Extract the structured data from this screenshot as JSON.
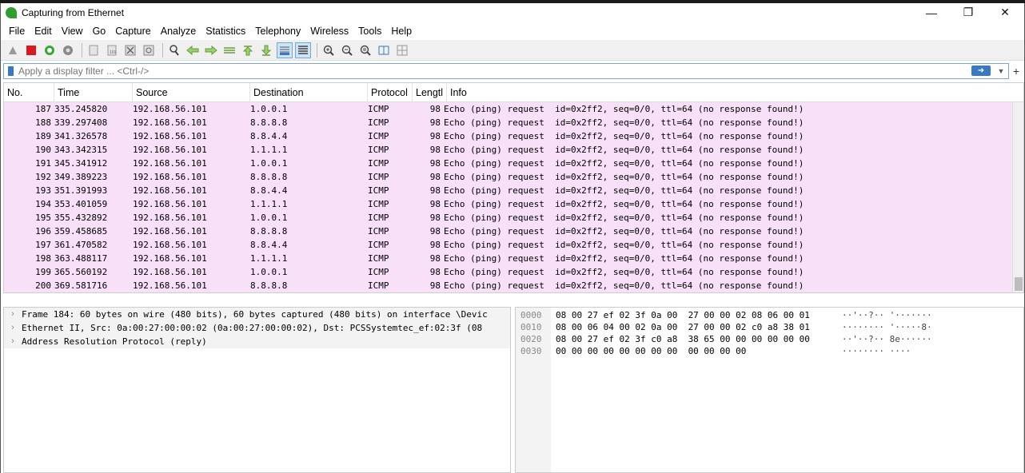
{
  "window": {
    "title": "Capturing from Ethernet",
    "minimize_icon": "minimize-icon",
    "restore_icon": "restore-icon",
    "close_icon": "close-icon"
  },
  "menu": [
    "File",
    "Edit",
    "View",
    "Go",
    "Capture",
    "Analyze",
    "Statistics",
    "Telephony",
    "Wireless",
    "Tools",
    "Help"
  ],
  "filter": {
    "placeholder": "Apply a display filter ... <Ctrl-/>",
    "apply_icon": "arrow-right-icon",
    "add_icon": "plus-icon"
  },
  "columns": {
    "no": "No.",
    "time": "Time",
    "source": "Source",
    "destination": "Destination",
    "protocol": "Protocol",
    "length": "Lengtl",
    "info": "Info"
  },
  "row_color": "#f9e0f9",
  "packets": [
    {
      "no": "187",
      "time": "335.245820",
      "src": "192.168.56.101",
      "dst": "1.0.0.1",
      "proto": "ICMP",
      "len": "98",
      "info": "Echo (ping) request  id=0x2ff2, seq=0/0, ttl=64 (no response found!)"
    },
    {
      "no": "188",
      "time": "339.297408",
      "src": "192.168.56.101",
      "dst": "8.8.8.8",
      "proto": "ICMP",
      "len": "98",
      "info": "Echo (ping) request  id=0x2ff2, seq=0/0, ttl=64 (no response found!)"
    },
    {
      "no": "189",
      "time": "341.326578",
      "src": "192.168.56.101",
      "dst": "8.8.4.4",
      "proto": "ICMP",
      "len": "98",
      "info": "Echo (ping) request  id=0x2ff2, seq=0/0, ttl=64 (no response found!)"
    },
    {
      "no": "190",
      "time": "343.342315",
      "src": "192.168.56.101",
      "dst": "1.1.1.1",
      "proto": "ICMP",
      "len": "98",
      "info": "Echo (ping) request  id=0x2ff2, seq=0/0, ttl=64 (no response found!)"
    },
    {
      "no": "191",
      "time": "345.341912",
      "src": "192.168.56.101",
      "dst": "1.0.0.1",
      "proto": "ICMP",
      "len": "98",
      "info": "Echo (ping) request  id=0x2ff2, seq=0/0, ttl=64 (no response found!)"
    },
    {
      "no": "192",
      "time": "349.389223",
      "src": "192.168.56.101",
      "dst": "8.8.8.8",
      "proto": "ICMP",
      "len": "98",
      "info": "Echo (ping) request  id=0x2ff2, seq=0/0, ttl=64 (no response found!)"
    },
    {
      "no": "193",
      "time": "351.391993",
      "src": "192.168.56.101",
      "dst": "8.8.4.4",
      "proto": "ICMP",
      "len": "98",
      "info": "Echo (ping) request  id=0x2ff2, seq=0/0, ttl=64 (no response found!)"
    },
    {
      "no": "194",
      "time": "353.401059",
      "src": "192.168.56.101",
      "dst": "1.1.1.1",
      "proto": "ICMP",
      "len": "98",
      "info": "Echo (ping) request  id=0x2ff2, seq=0/0, ttl=64 (no response found!)"
    },
    {
      "no": "195",
      "time": "355.432892",
      "src": "192.168.56.101",
      "dst": "1.0.0.1",
      "proto": "ICMP",
      "len": "98",
      "info": "Echo (ping) request  id=0x2ff2, seq=0/0, ttl=64 (no response found!)"
    },
    {
      "no": "196",
      "time": "359.458685",
      "src": "192.168.56.101",
      "dst": "8.8.8.8",
      "proto": "ICMP",
      "len": "98",
      "info": "Echo (ping) request  id=0x2ff2, seq=0/0, ttl=64 (no response found!)"
    },
    {
      "no": "197",
      "time": "361.470582",
      "src": "192.168.56.101",
      "dst": "8.8.4.4",
      "proto": "ICMP",
      "len": "98",
      "info": "Echo (ping) request  id=0x2ff2, seq=0/0, ttl=64 (no response found!)"
    },
    {
      "no": "198",
      "time": "363.488117",
      "src": "192.168.56.101",
      "dst": "1.1.1.1",
      "proto": "ICMP",
      "len": "98",
      "info": "Echo (ping) request  id=0x2ff2, seq=0/0, ttl=64 (no response found!)"
    },
    {
      "no": "199",
      "time": "365.560192",
      "src": "192.168.56.101",
      "dst": "1.0.0.1",
      "proto": "ICMP",
      "len": "98",
      "info": "Echo (ping) request  id=0x2ff2, seq=0/0, ttl=64 (no response found!)"
    },
    {
      "no": "200",
      "time": "369.581716",
      "src": "192.168.56.101",
      "dst": "8.8.8.8",
      "proto": "ICMP",
      "len": "98",
      "info": "Echo (ping) request  id=0x2ff2, seq=0/0, ttl=64 (no response found!)"
    }
  ],
  "details": [
    "Frame 184: 60 bytes on wire (480 bits), 60 bytes captured (480 bits) on interface \\Devic",
    "Ethernet II, Src: 0a:00:27:00:00:02 (0a:00:27:00:00:02), Dst: PCSSystemtec_ef:02:3f (08",
    "Address Resolution Protocol (reply)"
  ],
  "hex": [
    {
      "offset": "0000",
      "bytes": "08 00 27 ef 02 3f 0a 00  27 00 00 02 08 06 00 01",
      "ascii": "··'··?·· '·······"
    },
    {
      "offset": "0010",
      "bytes": "08 00 06 04 00 02 0a 00  27 00 00 02 c0 a8 38 01",
      "ascii": "········ '·····8·"
    },
    {
      "offset": "0020",
      "bytes": "08 00 27 ef 02 3f c0 a8  38 65 00 00 00 00 00 00",
      "ascii": "··'··?·· 8e······"
    },
    {
      "offset": "0030",
      "bytes": "00 00 00 00 00 00 00 00  00 00 00 00",
      "ascii": "········ ····"
    }
  ]
}
